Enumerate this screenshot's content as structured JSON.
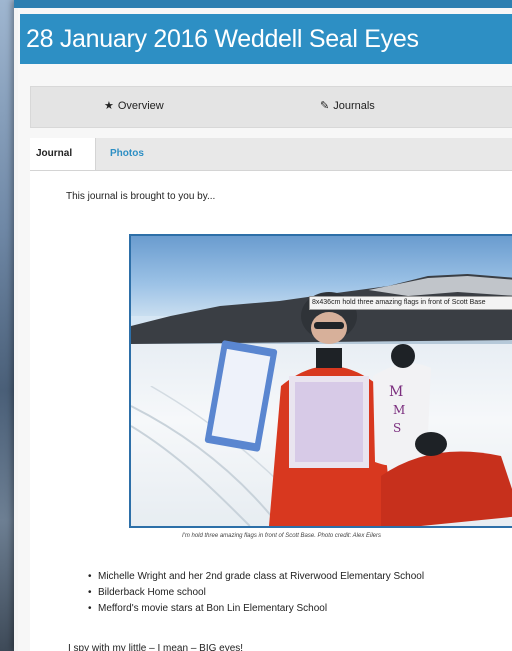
{
  "page": {
    "title": "28 January 2016 Weddell Seal Eyes"
  },
  "nav": {
    "items": [
      {
        "label": "Overview",
        "icon": "star-icon"
      },
      {
        "label": "Journals",
        "icon": "pencil-icon"
      }
    ]
  },
  "tabs": [
    {
      "label": "Journal",
      "active": true
    },
    {
      "label": "Photos",
      "active": false
    }
  ],
  "journal": {
    "intro": "This journal is brought to you by...",
    "photo_tooltip": "8x436cm hold three amazing flags in front of Scott Base",
    "photo_caption": "I'm hold three amazing flags in front of Scott Base. Photo credit: Alex Eilers",
    "bullets": [
      "Michelle Wright and her 2nd grade class at Riverwood Elementary School",
      "Bilderback Home school",
      "Mefford's movie stars at Bon Lin Elementary School"
    ],
    "closing": "I spy with my little – I mean – BIG eyes!"
  },
  "colors": {
    "accent": "#2d8fc4",
    "link": "#2d8fc4",
    "frame_border": "#2d6fa8"
  }
}
